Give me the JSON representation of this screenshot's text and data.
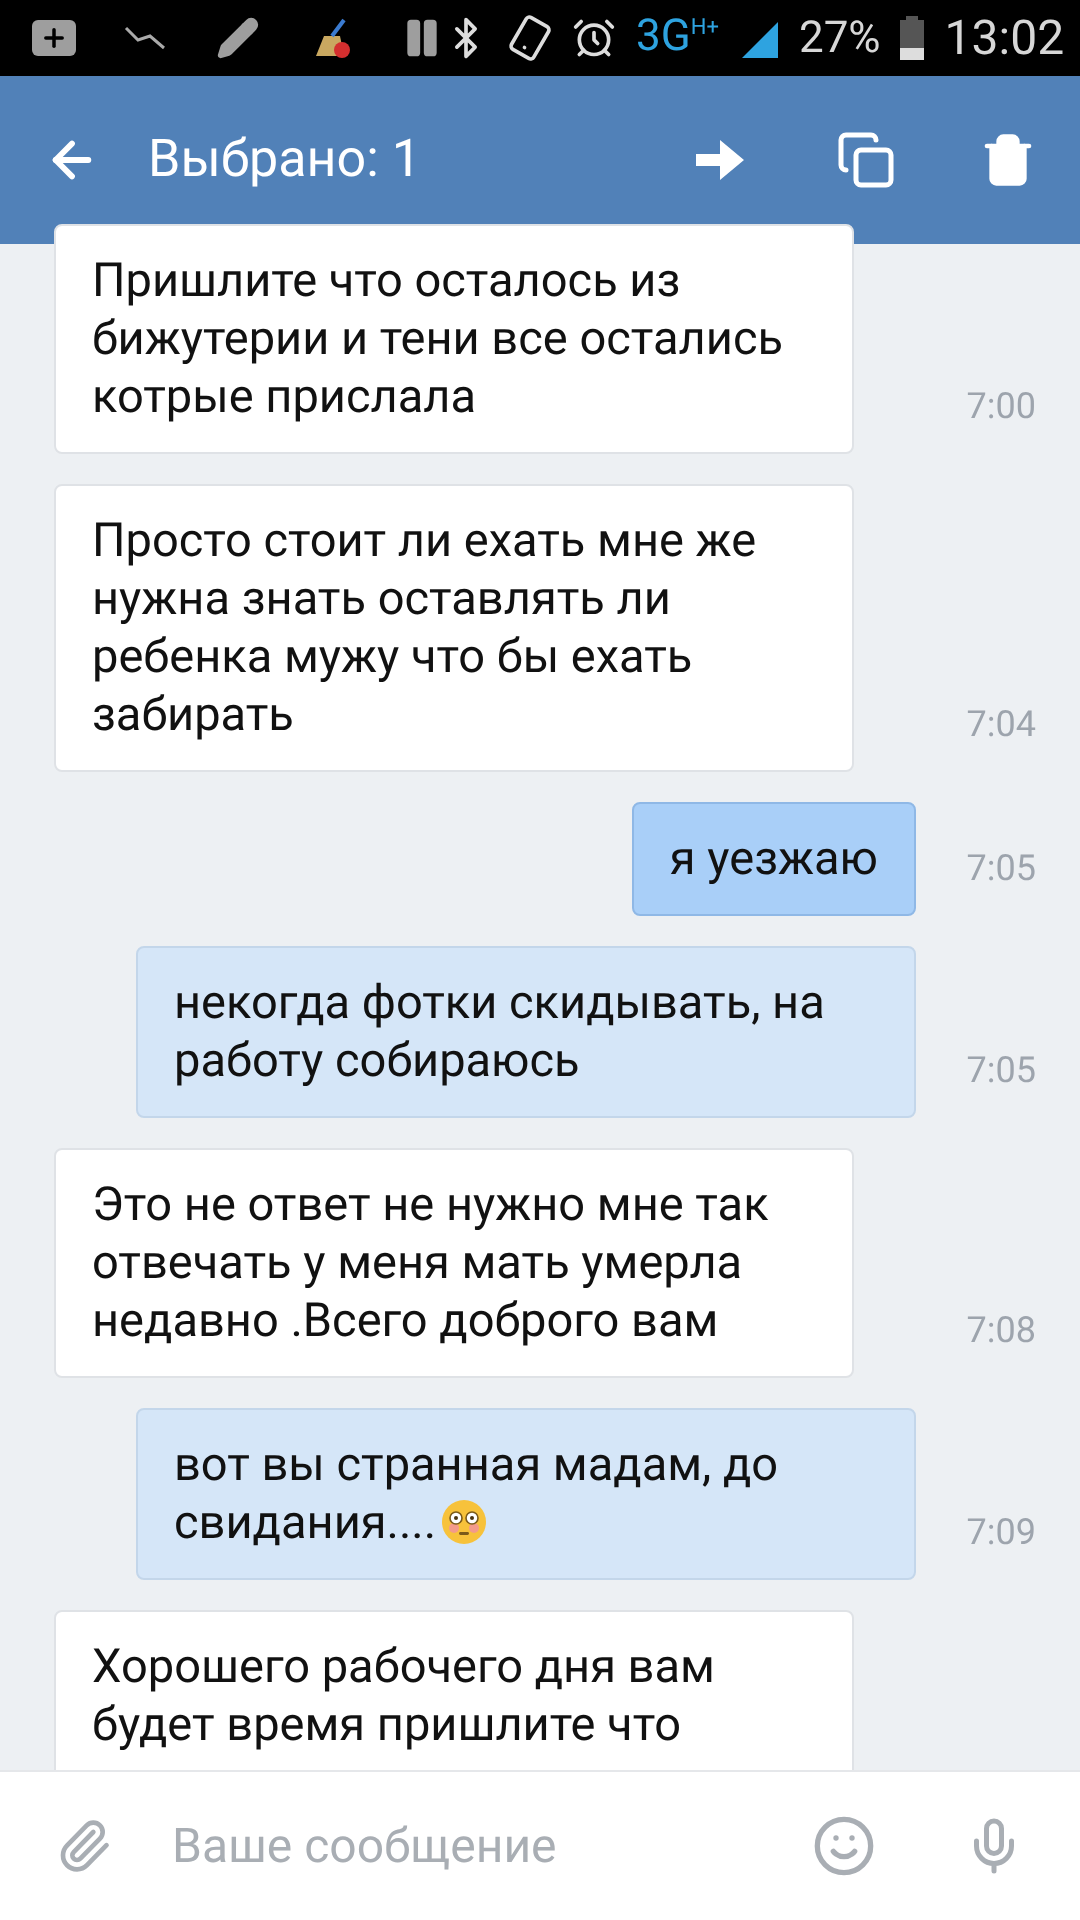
{
  "status_bar": {
    "network": "3G",
    "network_sub": "H+",
    "battery": "27%",
    "time": "13:02"
  },
  "toolbar": {
    "title": "Выбрано: 1"
  },
  "messages": [
    {
      "kind": "incoming",
      "selected": false,
      "text": "Пришлите что осталось из бижутерии и тени все остались котрые прислала",
      "time": "7:00"
    },
    {
      "kind": "incoming",
      "selected": false,
      "text": "Просто стоит ли ехать мне же нужна знать оставлять ли ребенка мужу что бы ехать забирать",
      "time": "7:04"
    },
    {
      "kind": "outgoing",
      "selected": true,
      "text": "я уезжаю",
      "time": "7:05"
    },
    {
      "kind": "outgoing",
      "selected": false,
      "text": "некогда фотки скидывать, на работу собираюсь",
      "time": "7:05"
    },
    {
      "kind": "incoming",
      "selected": false,
      "text": "Это не ответ не нужно мне так отвечать у меня мать умерла недавно .Всего доброго вам",
      "time": "7:08"
    },
    {
      "kind": "outgoing",
      "selected": false,
      "text": "вот вы странная мадам, до свидания....",
      "emoji": true,
      "time": "7:09"
    },
    {
      "kind": "incoming",
      "selected": false,
      "text": "Хорошего рабочего дня вам будет время пришлите что"
    }
  ],
  "composer": {
    "placeholder": "Ваше сообщение"
  }
}
